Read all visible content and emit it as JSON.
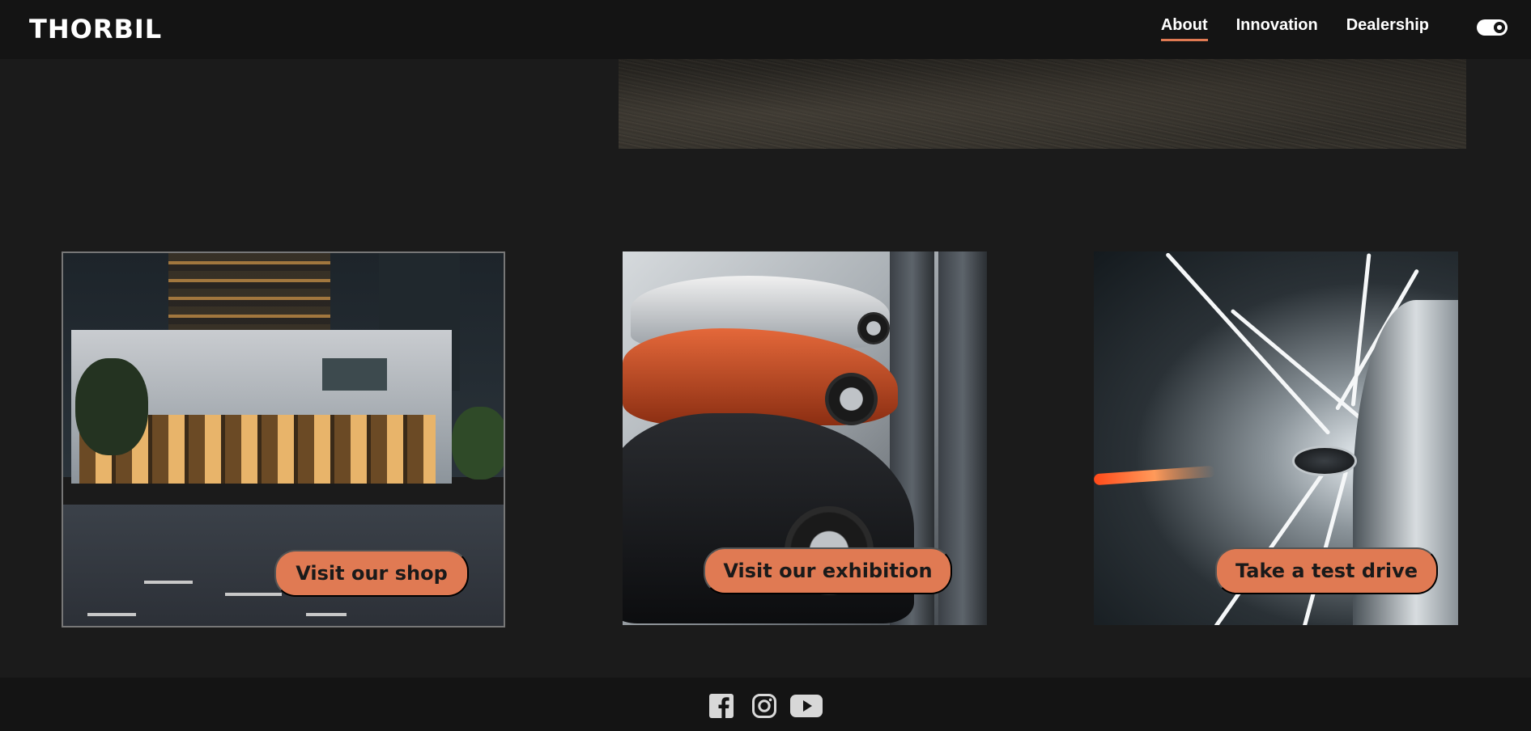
{
  "header": {
    "logo": "THORBIL",
    "nav": [
      {
        "label": "About",
        "active": true
      },
      {
        "label": "Innovation",
        "active": false
      },
      {
        "label": "Dealership",
        "active": false
      }
    ],
    "theme_toggle_icon": "theme-toggle-icon"
  },
  "cards": [
    {
      "image": "dealership-storefront-photo",
      "cta_label": "Visit our shop"
    },
    {
      "image": "parked-sports-cars-photo",
      "cta_label": "Visit our exhibition"
    },
    {
      "image": "car-in-tunnel-motion-photo",
      "cta_label": "Take a test drive"
    }
  ],
  "footer": {
    "social": [
      "facebook-icon",
      "instagram-icon",
      "youtube-icon"
    ]
  },
  "colors": {
    "accent": "#e07a53",
    "background": "#1b1b1b",
    "header_bg": "#141414"
  }
}
